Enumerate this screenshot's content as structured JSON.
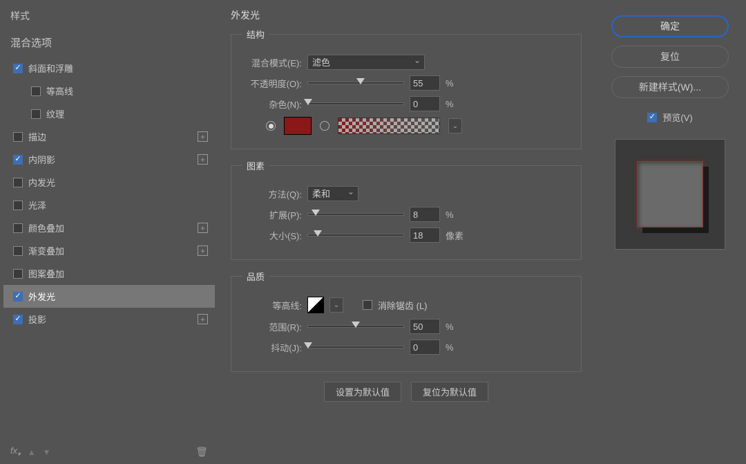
{
  "left": {
    "header": "样式",
    "blend": "混合选项",
    "items": [
      {
        "label": "斜面和浮雕",
        "checked": true,
        "sub": false,
        "plus": false
      },
      {
        "label": "等高线",
        "checked": false,
        "sub": true,
        "plus": false
      },
      {
        "label": "纹理",
        "checked": false,
        "sub": true,
        "plus": false
      },
      {
        "label": "描边",
        "checked": false,
        "sub": false,
        "plus": true
      },
      {
        "label": "内阴影",
        "checked": true,
        "sub": false,
        "plus": true
      },
      {
        "label": "内发光",
        "checked": false,
        "sub": false,
        "plus": false
      },
      {
        "label": "光泽",
        "checked": false,
        "sub": false,
        "plus": false
      },
      {
        "label": "颜色叠加",
        "checked": false,
        "sub": false,
        "plus": true
      },
      {
        "label": "渐变叠加",
        "checked": false,
        "sub": false,
        "plus": true
      },
      {
        "label": "图案叠加",
        "checked": false,
        "sub": false,
        "plus": false
      },
      {
        "label": "外发光",
        "checked": true,
        "sub": false,
        "plus": false,
        "selected": true
      },
      {
        "label": "投影",
        "checked": true,
        "sub": false,
        "plus": true
      }
    ],
    "footer_fx": "fx"
  },
  "center": {
    "title": "外发光",
    "structure": {
      "legend": "结构",
      "blend_mode_label": "混合模式(E):",
      "blend_mode_value": "滤色",
      "opacity_label": "不透明度(O):",
      "opacity_value": "55",
      "opacity_unit": "%",
      "noise_label": "杂色(N):",
      "noise_value": "0",
      "noise_unit": "%",
      "color_hex": "#8b1818"
    },
    "elements": {
      "legend": "图素",
      "method_label": "方法(Q):",
      "method_value": "柔和",
      "spread_label": "扩展(P):",
      "spread_value": "8",
      "spread_unit": "%",
      "size_label": "大小(S):",
      "size_value": "18",
      "size_unit": "像素"
    },
    "quality": {
      "legend": "品质",
      "contour_label": "等高线:",
      "antialias_label": "消除锯齿 (L)",
      "range_label": "范围(R):",
      "range_value": "50",
      "range_unit": "%",
      "jitter_label": "抖动(J):",
      "jitter_value": "0",
      "jitter_unit": "%"
    },
    "buttons": {
      "default": "设置为默认值",
      "reset": "复位为默认值"
    }
  },
  "right": {
    "ok": "确定",
    "reset": "复位",
    "new_style": "新建样式(W)...",
    "preview": "预览(V)"
  }
}
